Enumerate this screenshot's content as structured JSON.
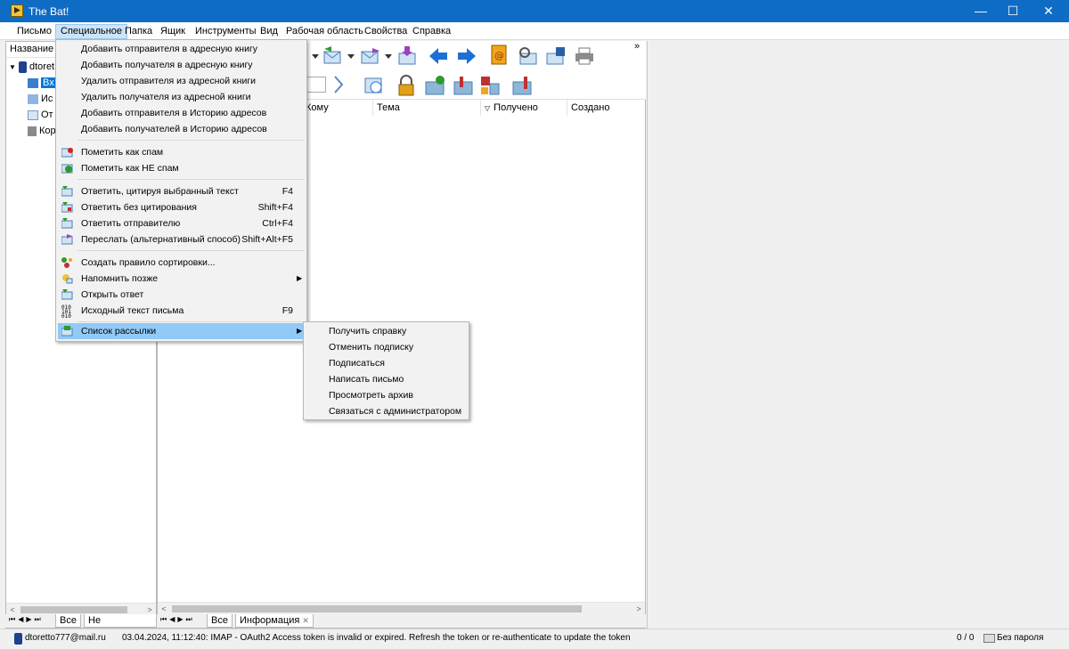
{
  "window": {
    "title": "The Bat!",
    "min": "—",
    "max": "☐",
    "close": "✕"
  },
  "menubar": [
    "Письмо",
    "Специальное",
    "Папка",
    "Ящик",
    "Инструменты",
    "Вид",
    "Рабочая область",
    "Свойства",
    "Справка"
  ],
  "folders": {
    "header": "Название",
    "account": "dtoret",
    "items": [
      "Вх",
      "Ис",
      "От",
      "Кор"
    ]
  },
  "folder_tabs": {
    "all": "Все",
    "unread": "Не прочитано"
  },
  "message_tabs": {
    "all": "Все",
    "info": "Информация"
  },
  "columns": [
    "Кому",
    "Тема",
    "Получено",
    "Создано"
  ],
  "special_menu": {
    "group1": [
      "Добавить отправителя в адресную книгу",
      "Добавить получателя в адресную книгу",
      "Удалить отправителя из адресной книги",
      "Удалить получателя из адресной книги",
      "Добавить отправителя в Историю адресов",
      "Добавить получателей в Историю адресов"
    ],
    "group2": [
      "Пометить как спам",
      "Пометить как НЕ спам"
    ],
    "group3": [
      {
        "label": "Ответить, цитируя выбранный текст",
        "shortcut": "F4"
      },
      {
        "label": "Ответить без цитирования",
        "shortcut": "Shift+F4"
      },
      {
        "label": "Ответить отправителю",
        "shortcut": "Ctrl+F4"
      },
      {
        "label": "Переслать (альтернативный способ)",
        "shortcut": "Shift+Alt+F5"
      }
    ],
    "group4": [
      {
        "label": "Создать правило сортировки...",
        "shortcut": ""
      },
      {
        "label": "Напомнить позже",
        "shortcut": ""
      },
      {
        "label": "Открыть ответ",
        "shortcut": ""
      },
      {
        "label": "Исходный текст письма",
        "shortcut": "F9"
      }
    ],
    "mailing_list": "Список рассылки"
  },
  "mailing_submenu": [
    "Получить справку",
    "Отменить подписку",
    "Подписаться",
    "Написать письмо",
    "Просмотреть архив",
    "Связаться с администратором"
  ],
  "status": {
    "account": "dtoretto777@mail.ru",
    "message": "03.04.2024, 11:12:40: IMAP  - OAuth2 Access token is invalid or expired. Refresh the token or re-authenticate to update the token",
    "count": "0 / 0",
    "password": "Без пароля"
  },
  "colors": {
    "titlebar": "#0f6cc4",
    "menu_highlight": "#91c9f7",
    "selection": "#0078d7"
  }
}
